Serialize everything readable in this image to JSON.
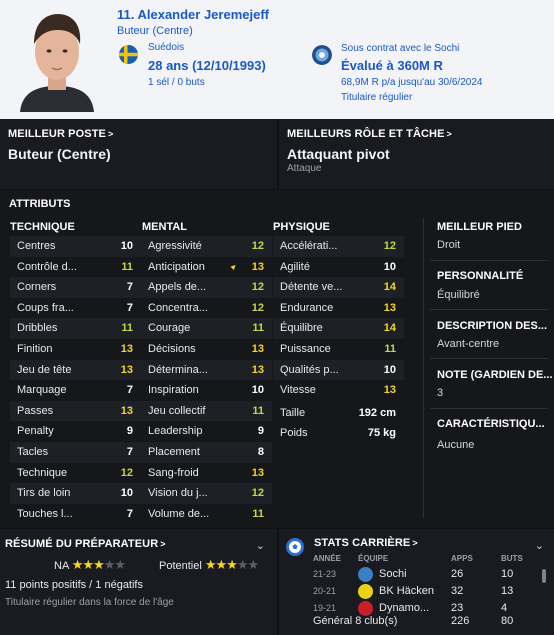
{
  "header": {
    "name": "11. Alexander Jeremejeff",
    "position": "Buteur (Centre)",
    "nationality": "Suédois",
    "age": "28 ans (12/10/1993)",
    "caps": "1 sél / 0 buts",
    "contract": "Sous contrat avec le Sochi",
    "value": "Évalué à 360M R",
    "wage": "68,9M R p/a jusqu'au 30/6/2024",
    "status": "Titulaire régulier"
  },
  "best_position": {
    "title": "MEILLEUR POSTE",
    "value": "Buteur (Centre)"
  },
  "best_role": {
    "title": "MEILLEURS RÔLE ET TÂCHE",
    "value": "Attaquant pivot",
    "duty": "Attaque"
  },
  "attributes": {
    "title": "ATTRIBUTS",
    "technical": {
      "header": "TECHNIQUE",
      "rows": [
        {
          "name": "Centres",
          "value": "10"
        },
        {
          "name": "Contrôle d...",
          "value": "11"
        },
        {
          "name": "Corners",
          "value": "7"
        },
        {
          "name": "Coups fra...",
          "value": "7"
        },
        {
          "name": "Dribbles",
          "value": "11"
        },
        {
          "name": "Finition",
          "value": "13"
        },
        {
          "name": "Jeu de tête",
          "value": "13"
        },
        {
          "name": "Marquage",
          "value": "7"
        },
        {
          "name": "Passes",
          "value": "13"
        },
        {
          "name": "Penalty",
          "value": "9"
        },
        {
          "name": "Tacles",
          "value": "7"
        },
        {
          "name": "Technique",
          "value": "12"
        },
        {
          "name": "Tirs de loin",
          "value": "10"
        },
        {
          "name": "Touches l...",
          "value": "7"
        }
      ]
    },
    "mental": {
      "header": "MENTAL",
      "rows": [
        {
          "name": "Agressivité",
          "value": "12"
        },
        {
          "name": "Anticipation",
          "value": "13"
        },
        {
          "name": "Appels de...",
          "value": "12"
        },
        {
          "name": "Concentra...",
          "value": "12"
        },
        {
          "name": "Courage",
          "value": "11"
        },
        {
          "name": "Décisions",
          "value": "13"
        },
        {
          "name": "Détermina...",
          "value": "13"
        },
        {
          "name": "Inspiration",
          "value": "10"
        },
        {
          "name": "Jeu collectif",
          "value": "11"
        },
        {
          "name": "Leadership",
          "value": "9"
        },
        {
          "name": "Placement",
          "value": "8"
        },
        {
          "name": "Sang-froid",
          "value": "13"
        },
        {
          "name": "Vision du j...",
          "value": "12"
        },
        {
          "name": "Volume de...",
          "value": "11"
        }
      ]
    },
    "physical": {
      "header": "PHYSIQUE",
      "rows": [
        {
          "name": "Accélérati...",
          "value": "12"
        },
        {
          "name": "Agilité",
          "value": "10"
        },
        {
          "name": "Détente ve...",
          "value": "14"
        },
        {
          "name": "Endurance",
          "value": "13"
        },
        {
          "name": "Équilibre",
          "value": "14"
        },
        {
          "name": "Puissance",
          "value": "11"
        },
        {
          "name": "Qualités p...",
          "value": "10"
        },
        {
          "name": "Vitesse",
          "value": "13"
        }
      ],
      "height_label": "Taille",
      "height": "192 cm",
      "weight_label": "Poids",
      "weight": "75 kg"
    }
  },
  "side": {
    "foot_title": "MEILLEUR PIED",
    "foot": "Droit",
    "personality_title": "PERSONNALITÉ",
    "personality": "Équilibré",
    "description_title": "DESCRIPTION DES...",
    "description": "Avant-centre",
    "gk_title": "NOTE (GARDIEN DE...",
    "gk": "3",
    "traits_title": "CARACTÉRISTIQU...",
    "traits": "Aucune"
  },
  "coach_report": {
    "title": "RÉSUMÉ DU PRÉPARATEUR",
    "ability_label": "NA",
    "ability_stars": 3,
    "potential_label": "Potentiel",
    "potential_stars": 3,
    "max_stars": 5,
    "summary": "11 points positifs / 1 négatifs",
    "note": "Titulaire régulier dans la force de l'âge"
  },
  "career": {
    "title": "STATS CARRIÈRE",
    "headers": {
      "year": "ANNÉE",
      "team": "ÉQUIPE",
      "apps": "APPS",
      "goals": "BUTS"
    },
    "rows": [
      {
        "year": "21-23",
        "club": "Sochi",
        "apps": "26",
        "goals": "10",
        "badge_color": "#3a7fc4"
      },
      {
        "year": "20-21",
        "club": "BK Häcken",
        "apps": "32",
        "goals": "13",
        "badge_color": "#e9d21a"
      },
      {
        "year": "19-21",
        "club": "Dynamo...",
        "apps": "23",
        "goals": "4",
        "badge_color": "#c8202a"
      }
    ],
    "total_label": "Général 8 club(s)",
    "total_apps": "226",
    "total_goals": "80"
  },
  "colors": {
    "highlight": "#f5d623",
    "accent_blue": "#1d58c7",
    "panel_bg": "#191b20"
  }
}
